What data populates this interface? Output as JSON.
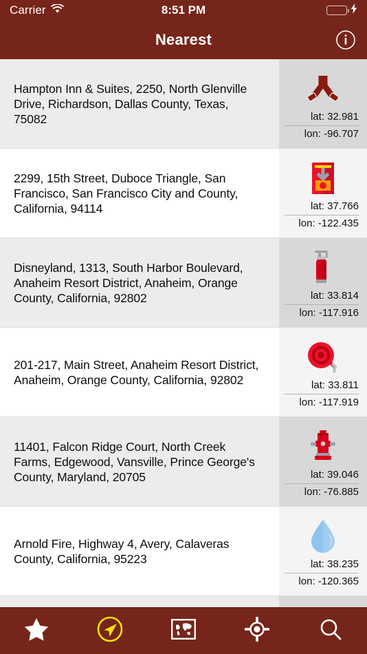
{
  "theme": {
    "brand": "#76251A",
    "accent_active": "#F5E400",
    "row_alt_bg": "#ECECEC",
    "info_bg": "#F4F4F4",
    "info_alt_bg": "#D8D8D8",
    "battery_green": "#4CD964"
  },
  "status_bar": {
    "carrier": "Carrier",
    "wifi_icon": "wifi-icon",
    "time": "8:51 PM",
    "battery_icon": "battery-icon",
    "charging_icon": "lightning-bolt-icon"
  },
  "nav_bar": {
    "title": "Nearest",
    "info_button": "info-circle-icon"
  },
  "list": {
    "rows": [
      {
        "address": "Hampton Inn & Suites, 2250, North Glenville Drive, Richardson, Dallas County, Texas, 75082",
        "icon": "fire-hose-wye-icon",
        "lat": "lat: 32.981",
        "lon": "lon: -96.707"
      },
      {
        "address": "2299, 15th Street, Duboce Triangle, San Francisco, San Francisco City and County, California, 94114",
        "icon": "fire-alarm-box-icon",
        "lat": "lat: 37.766",
        "lon": "lon: -122.435"
      },
      {
        "address": "Disneyland, 1313, South Harbor Boulevard, Anaheim Resort District, Anaheim, Orange County, California, 92802",
        "icon": "fire-extinguisher-icon",
        "lat": "lat: 33.814",
        "lon": "lon: -117.916"
      },
      {
        "address": "201-217, Main Street, Anaheim Resort District, Anaheim, Orange County, California, 92802",
        "icon": "fire-hose-reel-icon",
        "lat": "lat: 33.811",
        "lon": "lon: -117.919"
      },
      {
        "address": "11401, Falcon Ridge Court, North Creek Farms, Edgewood, Vansville, Prince George's County, Maryland, 20705",
        "icon": "fire-hydrant-icon",
        "lat": "lat: 39.046",
        "lon": "lon: -76.885"
      },
      {
        "address": "Arnold Fire, Highway 4, Avery, Calaveras County, California, 95223",
        "icon": "water-drop-icon",
        "lat": "lat: 38.235",
        "lon": "lon: -120.365"
      }
    ]
  },
  "tab_bar": {
    "tabs": [
      {
        "name": "favorites",
        "icon": "star-icon",
        "active": false
      },
      {
        "name": "nearest",
        "icon": "navigation-arrow-circle-icon",
        "active": true
      },
      {
        "name": "map",
        "icon": "world-map-icon",
        "active": false
      },
      {
        "name": "locate",
        "icon": "crosshair-location-icon",
        "active": false
      },
      {
        "name": "search",
        "icon": "magnifier-icon",
        "active": false
      }
    ]
  }
}
